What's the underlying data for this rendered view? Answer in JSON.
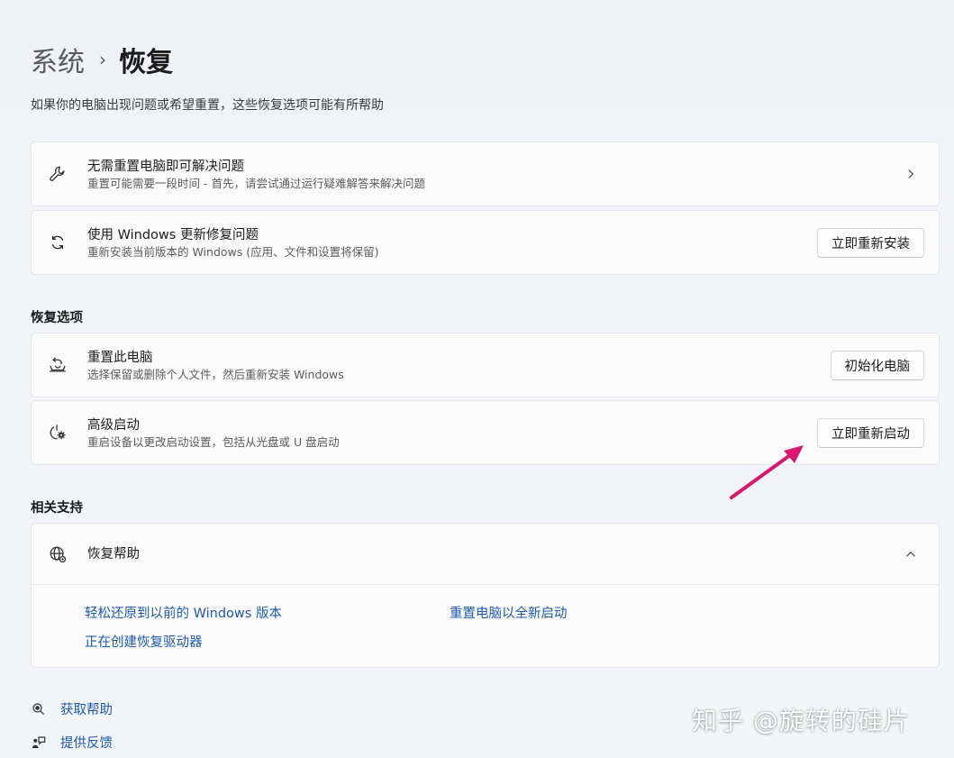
{
  "header": {
    "breadcrumb_parent": "系统",
    "breadcrumb_separator": "›",
    "breadcrumb_current": "恢复",
    "description": "如果你的电脑出现问题或希望重置，这些恢复选项可能有所帮助"
  },
  "troubleshoot": {
    "title": "无需重置电脑即可解决问题",
    "subtitle": "重置可能需要一段时间 - 首先，请尝试通过运行疑难解答来解决问题",
    "icon": "wrench-icon"
  },
  "windows_update_fix": {
    "title": "使用 Windows 更新修复问题",
    "subtitle": "重新安装当前版本的 Windows (应用、文件和设置将保留)",
    "button": "立即重新安装",
    "icon": "sync-icon"
  },
  "recovery_options": {
    "heading": "恢复选项",
    "reset_pc": {
      "title": "重置此电脑",
      "subtitle": "选择保留或删除个人文件，然后重新安装 Windows",
      "button": "初始化电脑",
      "icon": "reset-pc-icon"
    },
    "advanced_startup": {
      "title": "高级启动",
      "subtitle": "重启设备以更改启动设置，包括从光盘或 U 盘启动",
      "button": "立即重新启动",
      "icon": "power-gear-icon"
    }
  },
  "related_support": {
    "heading": "相关支持",
    "recovery_help": {
      "title": "恢复帮助",
      "icon": "globe-icon",
      "links": [
        "轻松还原到以前的 Windows 版本",
        "重置电脑以全新启动",
        "正在创建恢复驱动器"
      ]
    }
  },
  "footer": {
    "get_help": "获取帮助",
    "give_feedback": "提供反馈"
  },
  "watermark": "知乎 @旋转的硅片",
  "colors": {
    "link": "#1f5aa8",
    "annotation_arrow": "#d6196f"
  }
}
